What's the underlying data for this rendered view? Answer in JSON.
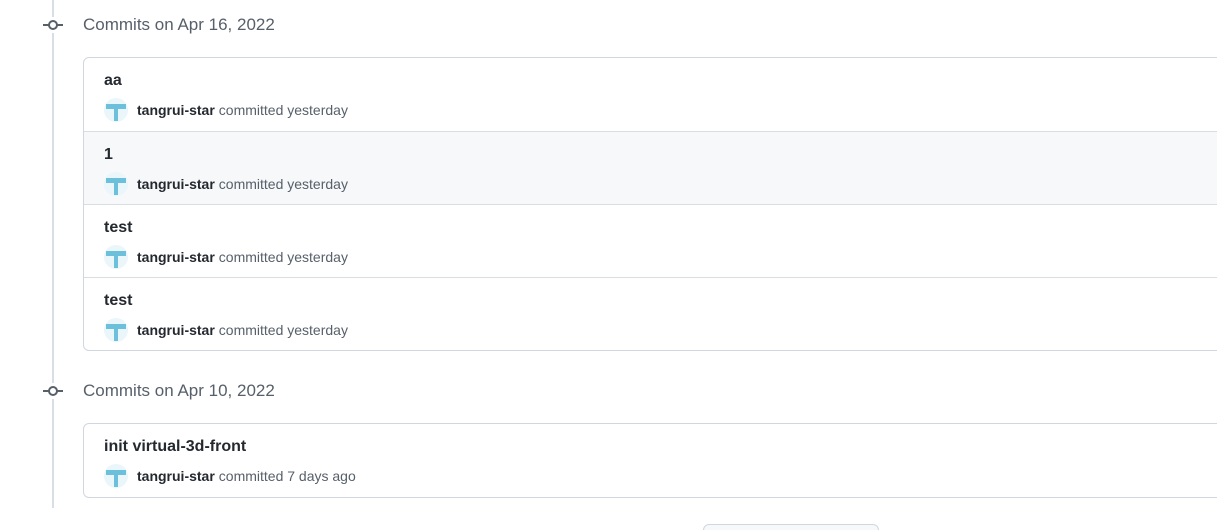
{
  "groups": [
    {
      "title": "Commits on Apr 16, 2022",
      "commits": [
        {
          "message": "aa",
          "author": "tangrui-star",
          "committed": "committed yesterday"
        },
        {
          "message": "1",
          "author": "tangrui-star",
          "committed": "committed yesterday"
        },
        {
          "message": "test",
          "author": "tangrui-star",
          "committed": "committed yesterday"
        },
        {
          "message": "test",
          "author": "tangrui-star",
          "committed": "committed yesterday"
        }
      ]
    },
    {
      "title": "Commits on Apr 10, 2022",
      "commits": [
        {
          "message": "init virtual-3d-front",
          "author": "tangrui-star",
          "committed": "committed 7 days ago"
        }
      ]
    }
  ],
  "icons": {
    "group_icon": "git-commit-icon",
    "avatar_icon": "avatar-icon"
  },
  "colors": {
    "avatar_accent": "#6cc0dc",
    "timeline": "#d8dee4",
    "row_highlight": "#f6f8fa"
  }
}
